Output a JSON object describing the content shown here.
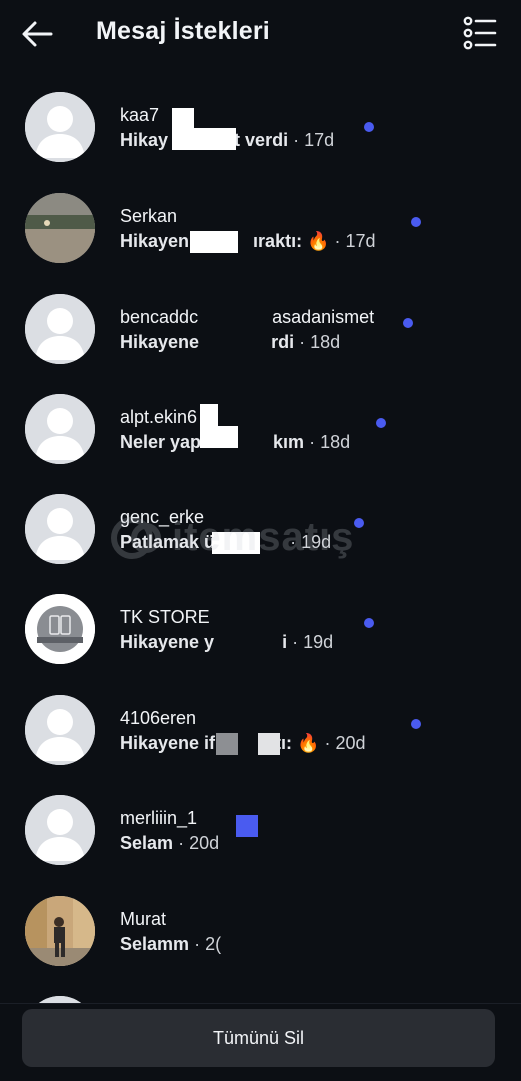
{
  "header": {
    "title": "Mesaj İstekleri",
    "back_icon": "arrow-left-icon",
    "filter_icon": "list-filter-icon"
  },
  "requests": [
    {
      "name": "kaa7",
      "preview": "Hikay",
      "preview_end": "t verdi",
      "time": "17d",
      "avatar": "placeholder",
      "unread": true
    },
    {
      "name": "Serkan",
      "preview": "Hikayen",
      "preview_end": "ıraktı: 🔥",
      "time": "17d",
      "avatar": "photo-landscape",
      "unread": true
    },
    {
      "name": "bencaddc",
      "name_end": "asadanismet",
      "preview": "Hikayene",
      "preview_end": "rdi",
      "time": "18d",
      "avatar": "placeholder",
      "unread": true
    },
    {
      "name": "alpt.ekin6",
      "preview": "Neler yap",
      "preview_end": "kım",
      "time": "18d",
      "avatar": "placeholder",
      "unread": true
    },
    {
      "name": "genc_erke",
      "preview": "Patlamak ü",
      "preview_end": "",
      "time": "19d",
      "avatar": "placeholder",
      "unread": true
    },
    {
      "name": "TK STORE",
      "preview": "Hikayene y",
      "preview_end": "i",
      "time": "19d",
      "avatar": "store-logo",
      "unread": true
    },
    {
      "name": "4106eren",
      "preview": "Hikayene if",
      "preview_end": "tı: 🔥",
      "time": "20d",
      "avatar": "placeholder",
      "unread": true
    },
    {
      "name": "merliiin_1",
      "preview": "Selam",
      "preview_end": "",
      "time": "20d",
      "avatar": "placeholder",
      "unread": false
    },
    {
      "name": "Murat",
      "preview": "Selamm",
      "preview_end": "",
      "time": "2(",
      "avatar": "photo-person",
      "unread": false
    }
  ],
  "separator": "·",
  "watermark": {
    "text": "itemsatış"
  },
  "footer": {
    "delete_all_label": "Tümünü Sil"
  },
  "colors": {
    "background": "#0c0f14",
    "unread_dot": "#4a5bf0",
    "button_bg": "#2a2d33"
  }
}
